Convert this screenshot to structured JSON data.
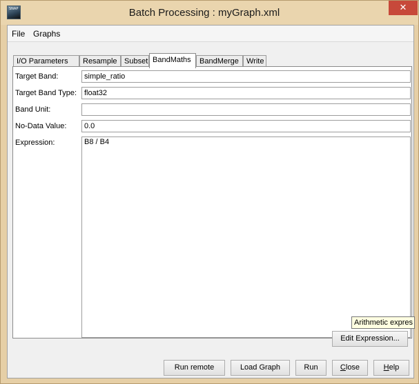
{
  "window": {
    "title": "Batch Processing : myGraph.xml",
    "icon_text": "SNAP",
    "close_glyph": "✕",
    "accent_color": "#c7493a"
  },
  "menu": {
    "items": [
      "File",
      "Graphs"
    ]
  },
  "tabs": {
    "items": [
      "I/O Parameters",
      "Resample",
      "Subset",
      "BandMaths",
      "BandMerge",
      "Write"
    ],
    "active": "BandMaths"
  },
  "form": {
    "target_band_label": "Target Band:",
    "target_band_value": "simple_ratio",
    "target_band_type_label": "Target Band Type:",
    "target_band_type_value": "float32",
    "band_unit_label": "Band Unit:",
    "band_unit_value": "",
    "nodata_label": "No-Data Value:",
    "nodata_value": "0.0",
    "expression_label": "Expression:",
    "expression_value": "B8 / B4"
  },
  "tooltip": {
    "text": "Arithmetic expres"
  },
  "buttons": {
    "edit_expression": "Edit Expression...",
    "run_remote": "Run remote",
    "load_graph": "Load Graph",
    "run": "Run",
    "close_first": "C",
    "close_rest": "lose",
    "help_first": "H",
    "help_rest": "elp"
  }
}
